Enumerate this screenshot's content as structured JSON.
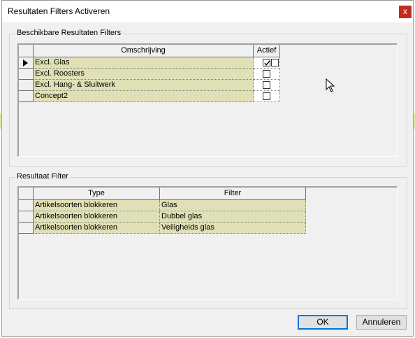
{
  "window": {
    "title": "Resultaten Filters Activeren",
    "close_label": "x"
  },
  "filters_group": {
    "label": "Beschikbare Resultaten Filters",
    "columns": [
      "Omschrijving",
      "Actief"
    ],
    "rows": [
      {
        "description": "Excl. Glas",
        "active": true,
        "current": true
      },
      {
        "description": "Excl. Roosters",
        "active": false,
        "current": false
      },
      {
        "description": "Excl. Hang- & Sluitwerk",
        "active": false,
        "current": false
      },
      {
        "description": "Concept2",
        "active": false,
        "current": false
      }
    ]
  },
  "result_group": {
    "label": "Resultaat  Filter",
    "columns": [
      "Type",
      "Filter"
    ],
    "rows": [
      {
        "type": "Artikelsoorten blokkeren",
        "filter": "Glas"
      },
      {
        "type": "Artikelsoorten blokkeren",
        "filter": "Dubbel glas"
      },
      {
        "type": "Artikelsoorten blokkeren",
        "filter": "Veiligheids glas"
      }
    ]
  },
  "buttons": {
    "ok": "OK",
    "cancel": "Annuleren"
  },
  "colors": {
    "row_fill": "#e0e0b6",
    "close_bg": "#c42b1c",
    "accent": "#0078d7"
  },
  "icons": {
    "row_pointer": "triangle-right-icon",
    "check": "checkmark-icon",
    "cursor": "mouse-pointer-icon"
  }
}
